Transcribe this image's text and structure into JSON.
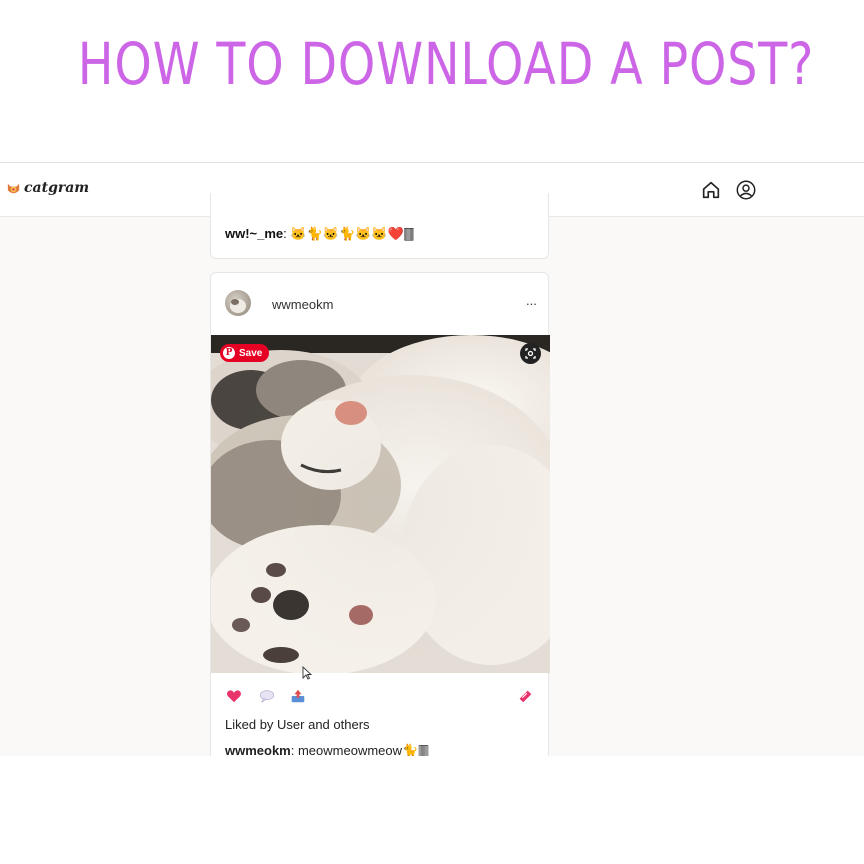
{
  "banner": {
    "title": "HOW TO DOWNLOAD A POST?"
  },
  "colors": {
    "title": "#cc66e6",
    "heart": "#e8336b",
    "pinterest": "#e60023"
  },
  "navbar": {
    "logo_text": "catgram",
    "icons": [
      "home-icon",
      "profile-icon"
    ]
  },
  "previous_post": {
    "caption_user": "ww!~_me",
    "caption_text": ": 🐱🐈🐱🐈🐱🐱❤️🀫"
  },
  "post": {
    "username": "wwmeokm",
    "more_label": "...",
    "pinterest_save_label": "Save",
    "pinterest_logo": "P",
    "actions": [
      "heart-icon",
      "comment-icon",
      "share-icon",
      "bookmark-icon"
    ],
    "liked_text": "Liked by User and others",
    "caption_user": "wwmeokm",
    "caption_text": ": meowmeowmeow🐈🀫"
  }
}
